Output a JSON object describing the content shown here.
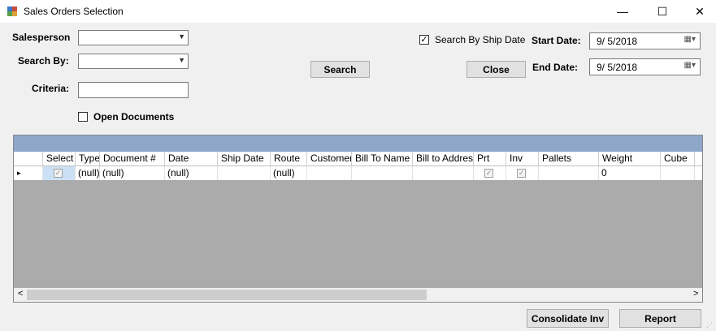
{
  "window": {
    "title": "Sales Orders Selection",
    "minimize": "—",
    "maximize": "☐",
    "close": "✕"
  },
  "form": {
    "salesperson_label": "Salesperson",
    "search_by_label": "Search By:",
    "criteria_label": "Criteria:",
    "open_documents_label": "Open Documents",
    "search_by_ship_date_label": "Search By Ship Date",
    "search_by_ship_date_checked": "✓",
    "search_button": "Search",
    "close_button": "Close",
    "start_date_label": "Start Date:",
    "start_date_value": "9/  5/2018",
    "end_date_label": "End  Date:",
    "end_date_value": "9/  5/2018"
  },
  "grid": {
    "columns": [
      "Select",
      "Type",
      "Document #",
      "Date",
      "Ship Date",
      "Route",
      "Customer",
      "Bill To Name",
      "Bill to Addres",
      "Prt",
      "Inv",
      "Pallets",
      "Weight",
      "Cube"
    ],
    "row": {
      "indicator": "▸",
      "type": "(null)",
      "document": "(null)",
      "date": "(null)",
      "ship_date": "",
      "route": "(null)",
      "weight": "0"
    },
    "scroll_left": "<",
    "scroll_right": ">"
  },
  "footer": {
    "consolidate_button": "Consolidate Inv",
    "report_button": "Report"
  },
  "colors": {
    "banner": "#8fa7c9",
    "grid_bg": "#ababab"
  }
}
